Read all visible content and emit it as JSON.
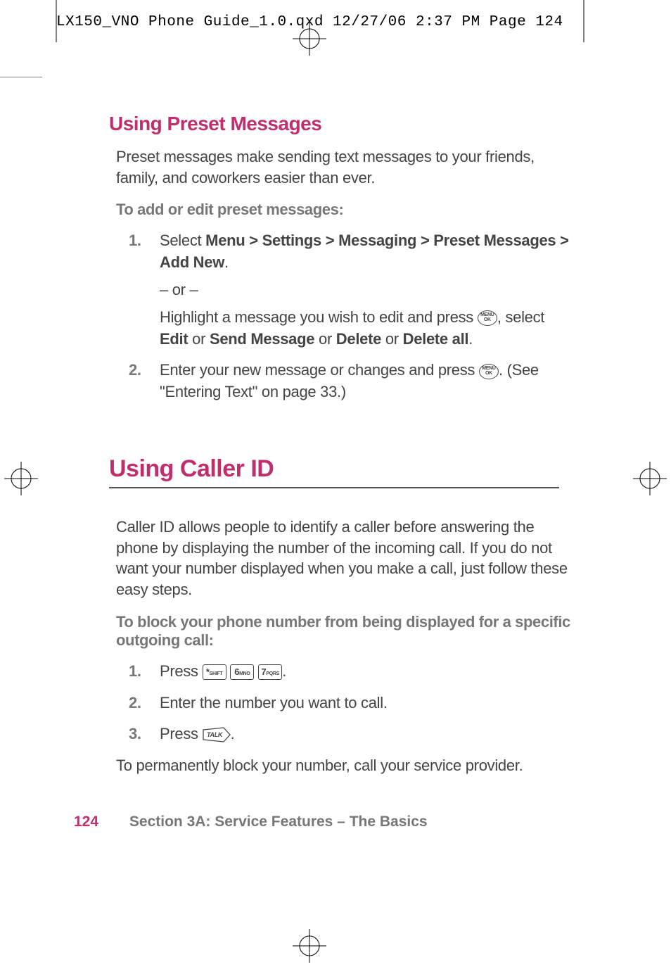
{
  "header": {
    "line": "LX150_VNO Phone Guide_1.0.qxd  12/27/06  2:37 PM  Page 124"
  },
  "section1": {
    "title": "Using Preset Messages",
    "intro": "Preset messages make sending text messages to your friends, family, and coworkers easier than ever.",
    "lead": "To add or edit preset messages:",
    "steps": [
      {
        "num": "1.",
        "pre": "Select ",
        "bold1": "Menu > Settings > Messaging > Preset Messages > Add New",
        "post1": ".",
        "or": "– or –",
        "line2a": "Highlight a message you wish to edit and press ",
        "line2b": ", select ",
        "b2": "Edit",
        "or2": " or ",
        "b3": "Send Message",
        "or3": " or ",
        "b4": "Delete",
        "or4": " or ",
        "b5": "Delete all",
        "end2": "."
      },
      {
        "num": "2.",
        "pre": "Enter your new message or changes and press ",
        "post": ". (See \"Entering Text\" on page 33.)"
      }
    ]
  },
  "section2": {
    "title": "Using Caller ID",
    "intro": "Caller ID allows people to identify a caller before answering the phone by displaying the number of the incoming call. If you do not want your number displayed when you make a call, just follow these easy steps.",
    "lead": "To block your phone number from being displayed for a specific outgoing call:",
    "steps": [
      {
        "num": "1.",
        "pre": "Press ",
        "post": "."
      },
      {
        "num": "2.",
        "text": "Enter the number you want to call."
      },
      {
        "num": "3.",
        "pre": "Press ",
        "post": "."
      }
    ],
    "closing": "To permanently block your number, call your service provider."
  },
  "keys": {
    "menu_ok_line1": "MENU",
    "menu_ok_line2": "OK",
    "star": "*",
    "star_sub": "SHIFT",
    "six": "6",
    "six_sub": "MNO",
    "seven": "7",
    "seven_sub": "PQRS",
    "talk": "TALK"
  },
  "footer": {
    "page": "124",
    "section": "Section 3A: Service Features – The Basics"
  }
}
